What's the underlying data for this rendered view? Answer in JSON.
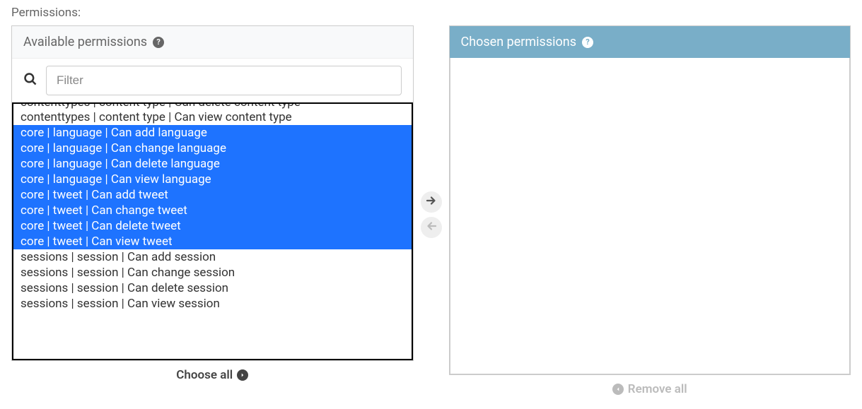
{
  "label": "Permissions:",
  "available": {
    "title": "Available permissions",
    "filter_placeholder": "Filter",
    "items": [
      {
        "label": "contenttypes | content type | Can delete content type",
        "selected": false,
        "cutoff": true
      },
      {
        "label": "contenttypes | content type | Can view content type",
        "selected": false
      },
      {
        "label": "core | language | Can add language",
        "selected": true
      },
      {
        "label": "core | language | Can change language",
        "selected": true
      },
      {
        "label": "core | language | Can delete language",
        "selected": true
      },
      {
        "label": "core | language | Can view language",
        "selected": true
      },
      {
        "label": "core | tweet | Can add tweet",
        "selected": true
      },
      {
        "label": "core | tweet | Can change tweet",
        "selected": true
      },
      {
        "label": "core | tweet | Can delete tweet",
        "selected": true
      },
      {
        "label": "core | tweet | Can view tweet",
        "selected": true
      },
      {
        "label": "sessions | session | Can add session",
        "selected": false
      },
      {
        "label": "sessions | session | Can change session",
        "selected": false
      },
      {
        "label": "sessions | session | Can delete session",
        "selected": false
      },
      {
        "label": "sessions | session | Can view session",
        "selected": false
      }
    ]
  },
  "chosen": {
    "title": "Chosen permissions"
  },
  "actions": {
    "choose_all": "Choose all",
    "remove_all": "Remove all"
  }
}
